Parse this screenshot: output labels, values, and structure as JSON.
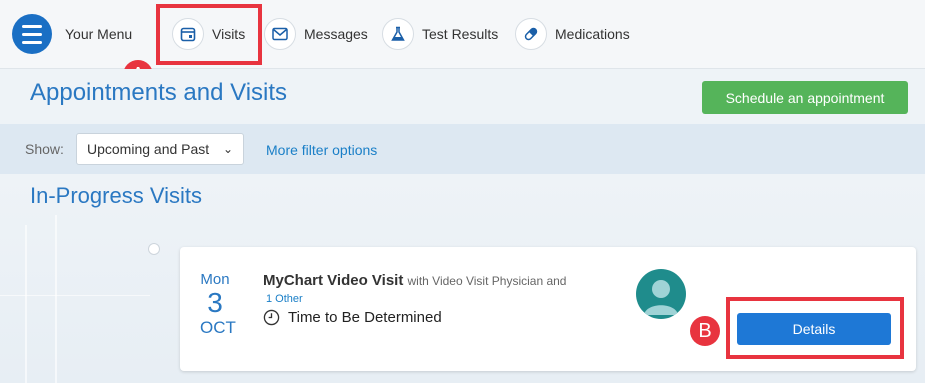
{
  "nav": {
    "menu_label": "Your Menu",
    "items": [
      {
        "label": "Visits",
        "icon": "calendar-icon"
      },
      {
        "label": "Messages",
        "icon": "envelope-icon"
      },
      {
        "label": "Test Results",
        "icon": "flask-icon"
      },
      {
        "label": "Medications",
        "icon": "pill-icon"
      }
    ]
  },
  "annotations": {
    "a": "A",
    "b": "B"
  },
  "page": {
    "title": "Appointments and Visits",
    "schedule_button": "Schedule an appointment"
  },
  "filter": {
    "show_label": "Show:",
    "selected": "Upcoming and Past",
    "more_link": "More filter options"
  },
  "section": {
    "title": "In-Progress Visits"
  },
  "visit": {
    "day_of_week": "Mon",
    "day": "3",
    "month": "OCT",
    "title": "MyChart Video Visit",
    "with_text": "with Video Visit Physician and",
    "other_link": "1 Other",
    "time": "Time to Be Determined",
    "details_button": "Details"
  },
  "colors": {
    "accent": "#2a78c2",
    "schedule_green": "#55b45a",
    "details_blue": "#1e78d6",
    "highlight_red": "#e8343f"
  }
}
